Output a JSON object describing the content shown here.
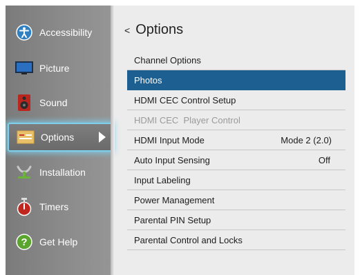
{
  "sidebar": {
    "items": [
      {
        "label": "Accessibility",
        "icon": "accessibility-icon"
      },
      {
        "label": "Picture",
        "icon": "picture-icon"
      },
      {
        "label": "Sound",
        "icon": "speaker-icon"
      },
      {
        "label": "Options",
        "icon": "options-icon",
        "selected": true
      },
      {
        "label": "Installation",
        "icon": "antenna-icon"
      },
      {
        "label": "Timers",
        "icon": "timer-icon"
      },
      {
        "label": "Get Help",
        "icon": "help-icon"
      }
    ]
  },
  "header": {
    "back_glyph": "<",
    "title": "Options"
  },
  "menu": {
    "items": [
      {
        "label": "Channel Options",
        "value": ""
      },
      {
        "label": "Photos",
        "value": "",
        "selected": true
      },
      {
        "label": "HDMI CEC Control Setup",
        "value": ""
      },
      {
        "label": "HDMI CEC  Player Control",
        "value": "",
        "disabled": true
      },
      {
        "label": "HDMI Input Mode",
        "value": "Mode 2 (2.0)"
      },
      {
        "label": "Auto Input Sensing",
        "value": "Off"
      },
      {
        "label": "Input Labeling",
        "value": ""
      },
      {
        "label": "Power Management",
        "value": ""
      },
      {
        "label": "Parental PIN Setup",
        "value": ""
      },
      {
        "label": "Parental Control and Locks",
        "value": ""
      }
    ]
  },
  "colors": {
    "selection": "#1d5f91",
    "focus_glow": "#7ed0ee",
    "sidebar": "#8a8a8a"
  }
}
